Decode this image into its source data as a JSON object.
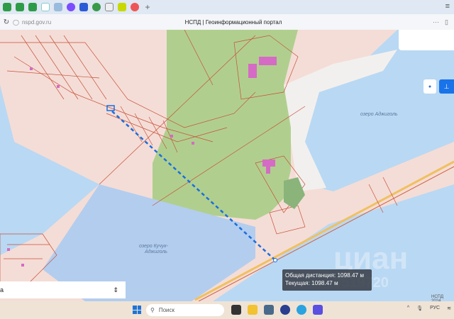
{
  "browser": {
    "url": "nspd.gov.ru",
    "title": "НСПД | Геоинформационный портал",
    "new_tab": "+",
    "menu_icon": "menu-icon",
    "more": "···"
  },
  "map": {
    "lake1": "озеро Аджиголь",
    "lake2_line1": "озеро Кучук-",
    "lake2_line2": "Аджиголь",
    "credit": "НСПД 2024",
    "watermark": "циан",
    "watermark_num": "0519720"
  },
  "tooltip": {
    "total": "Общая дистанция: 1098.47 м",
    "current": "Текущая: 1098.47 м"
  },
  "layer_select": {
    "value": "а"
  },
  "colors": {
    "water": "#b9d8f3",
    "land": "#f4ddd6",
    "park": "#a9cd86",
    "measure": "#1a6ee0",
    "accent": "#1a73e8"
  },
  "taskbar": {
    "search_placeholder": "Поиск",
    "lang": "РУС"
  }
}
